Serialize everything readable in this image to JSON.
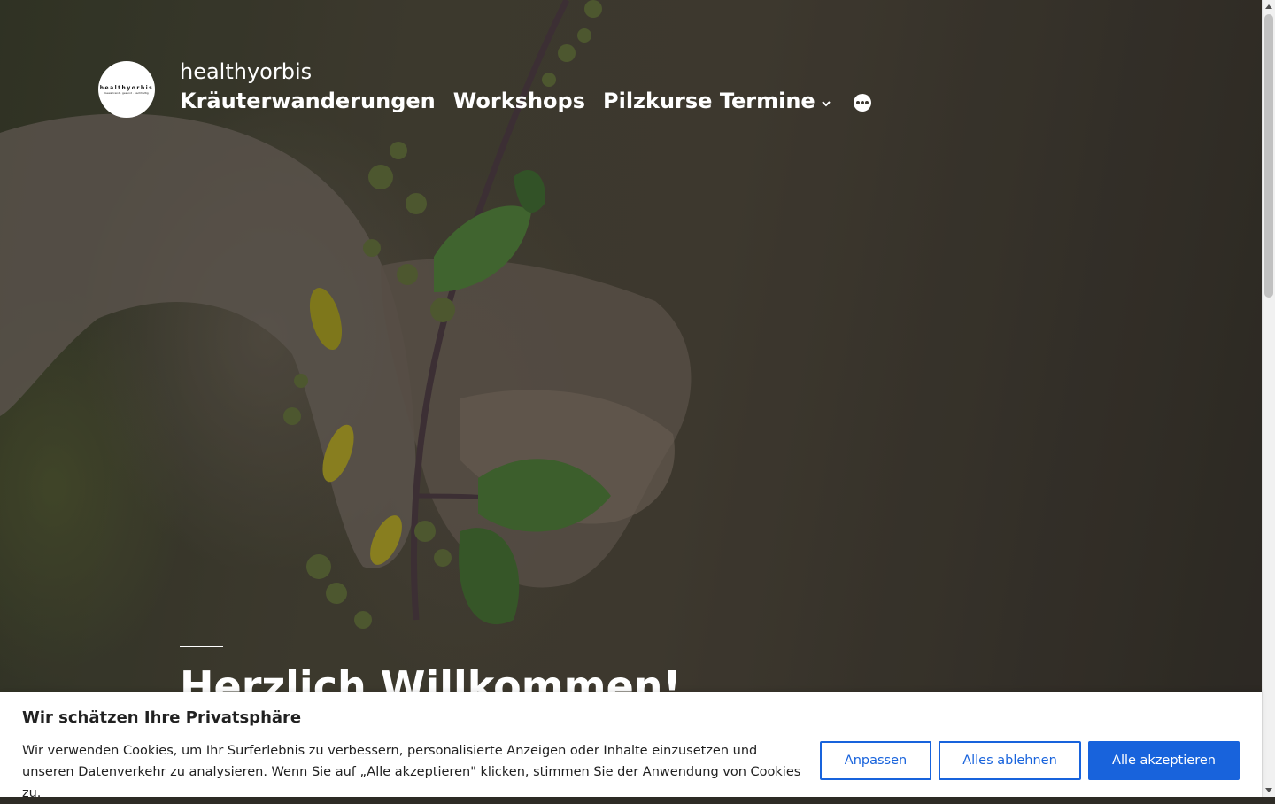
{
  "site": {
    "logo_text": "healthyorbis",
    "logo_tagline": "bewahrend · gesund · nachhaltig",
    "title": "healthyorbis"
  },
  "nav": {
    "items": [
      {
        "label": "Kräuterwanderungen"
      },
      {
        "label": "Workshops"
      },
      {
        "label": "Pilzkurse Termine",
        "has_dropdown": true
      }
    ],
    "more_icon": "more-horizontal-icon"
  },
  "hero": {
    "title": "Herzlich Willkommen!"
  },
  "cookie_banner": {
    "heading": "Wir schätzen Ihre Privatsphäre",
    "text": "Wir verwenden Cookies, um Ihr Surferlebnis zu verbessern, personalisierte Anzeigen oder Inhalte einzusetzen und unseren Datenverkehr zu analysieren. Wenn Sie auf „Alle akzeptieren\" klicken, stimmen Sie der Anwendung von Cookies zu.",
    "customize_label": "Anpassen",
    "reject_label": "Alles ablehnen",
    "accept_label": "Alle akzeptieren"
  },
  "colors": {
    "accent": "#1863dc",
    "banner_text": "#212121"
  }
}
